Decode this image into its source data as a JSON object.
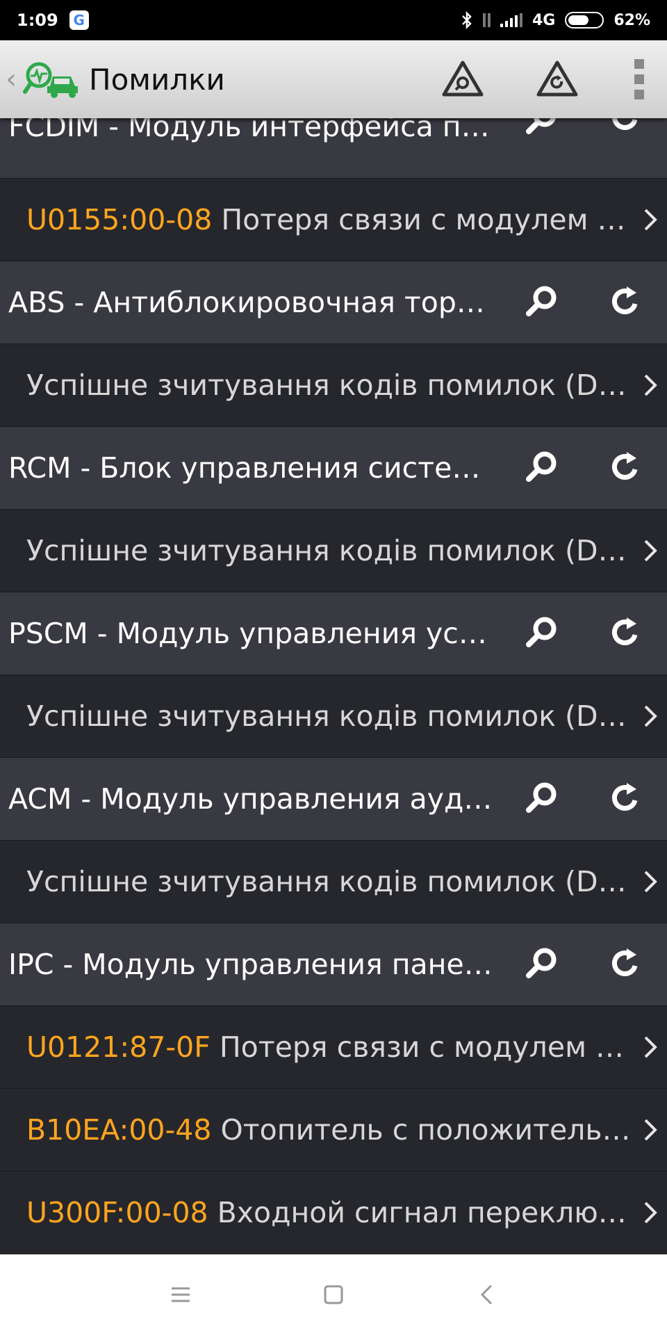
{
  "status_bar": {
    "time": "1:09",
    "google_badge": "G",
    "network": "4G",
    "battery": "62%",
    "battery_level": 0.62
  },
  "app_bar": {
    "back_icon": "chevron-left-icon",
    "logo_icon": "car-diagnostics-icon",
    "title": "Помилки",
    "actions": [
      "triangle-search-icon",
      "triangle-refresh-icon",
      "overflow-menu-icon"
    ]
  },
  "list": {
    "rows": [
      {
        "type": "module",
        "text": "FCDIM - Модуль интерфейса пе…"
      },
      {
        "type": "dtc",
        "code": "U0155:00-08",
        "text": " Потеря связи с модулем уп…"
      },
      {
        "type": "module",
        "text": "ABS - Антиблокировочная торм…"
      },
      {
        "type": "dtc",
        "code": "",
        "text": "Успішне зчитування кодів помилок (DTC…"
      },
      {
        "type": "module",
        "text": "RCM - Блок управления систем…"
      },
      {
        "type": "dtc",
        "code": "",
        "text": "Успішне зчитування кодів помилок (DTC…"
      },
      {
        "type": "module",
        "text": "PSCM - Модуль управления уси…"
      },
      {
        "type": "dtc",
        "code": "",
        "text": "Успішне зчитування кодів помилок (DTC…"
      },
      {
        "type": "module",
        "text": "ACM - Модуль управления ауди…"
      },
      {
        "type": "dtc",
        "code": "",
        "text": "Успішне зчитування кодів помилок (DTC…"
      },
      {
        "type": "module",
        "text": "IPC - Модуль управления панел…"
      },
      {
        "type": "dtc",
        "code": "U0121:87-0F",
        "text": " Потеря связи с модулем «А…"
      },
      {
        "type": "dtc",
        "code": "B10EA:00-48",
        "text": " Отопитель с положительны…"
      },
      {
        "type": "dtc",
        "code": "U300F:00-08",
        "text": " Входной сигнал переключа…"
      }
    ]
  },
  "colors": {
    "module_bg": "#393a41",
    "dtc_bg": "#26272c",
    "code_color": "#ffa51f"
  },
  "nav_bar": {
    "buttons": [
      "menu-icon",
      "home-square-icon",
      "back-icon"
    ]
  }
}
